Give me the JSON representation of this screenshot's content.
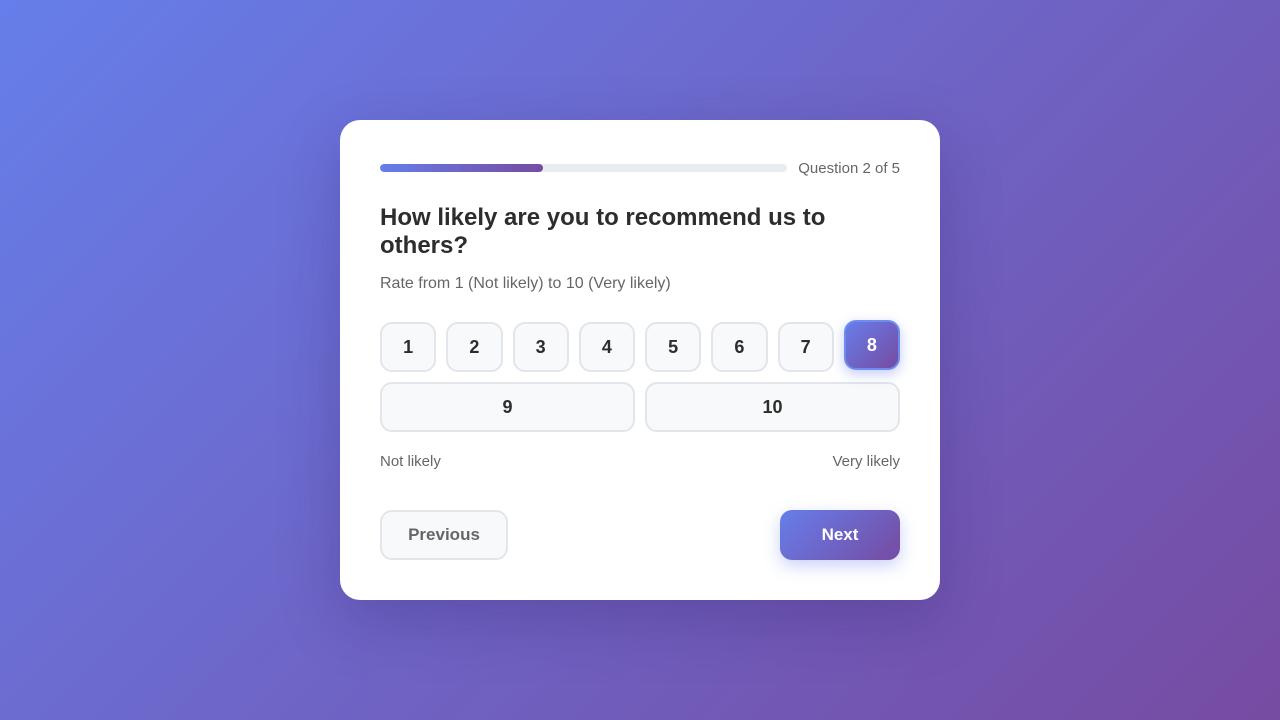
{
  "survey": {
    "progress": {
      "text": "Question 2 of 5",
      "fraction": 0.4
    },
    "question": {
      "title": "How likely are you to recommend us to others?",
      "subtitle": "Rate from 1 (Not likely) to 10 (Very likely)"
    },
    "scale": {
      "options": [
        "1",
        "2",
        "3",
        "4",
        "5",
        "6",
        "7",
        "8",
        "9",
        "10"
      ],
      "selected": "8",
      "low_label": "Not likely",
      "high_label": "Very likely"
    },
    "nav": {
      "previous_label": "Previous",
      "next_label": "Next"
    }
  },
  "colors": {
    "gradient_start": "#667eea",
    "gradient_end": "#764ba2",
    "card": "#ffffff",
    "text_dark": "#2d2d2d",
    "text_muted": "#666666"
  }
}
